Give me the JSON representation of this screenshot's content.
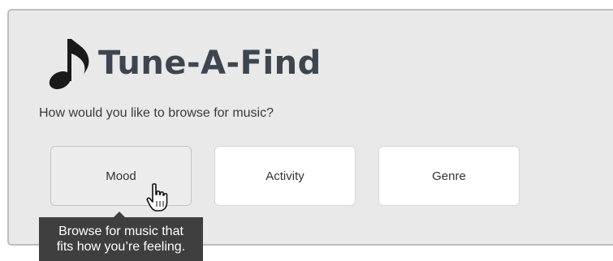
{
  "app": {
    "title": "Tune-A-Find",
    "logo_icon": "music-note-icon"
  },
  "prompt": "How would you like to browse for music?",
  "options": [
    {
      "label": "Mood",
      "state": "hovered"
    },
    {
      "label": "Activity",
      "state": "normal"
    },
    {
      "label": "Genre",
      "state": "normal"
    }
  ],
  "tooltip": {
    "line1": "Browse for music that",
    "line2": "fits how you’re feeling."
  },
  "cursor_icon": "hand-pointer-icon",
  "colors": {
    "title": "#3d4650",
    "panel_bg": "#e9e9e9",
    "tooltip_bg": "#3f3f3f",
    "hover_bg": "#ececec"
  }
}
